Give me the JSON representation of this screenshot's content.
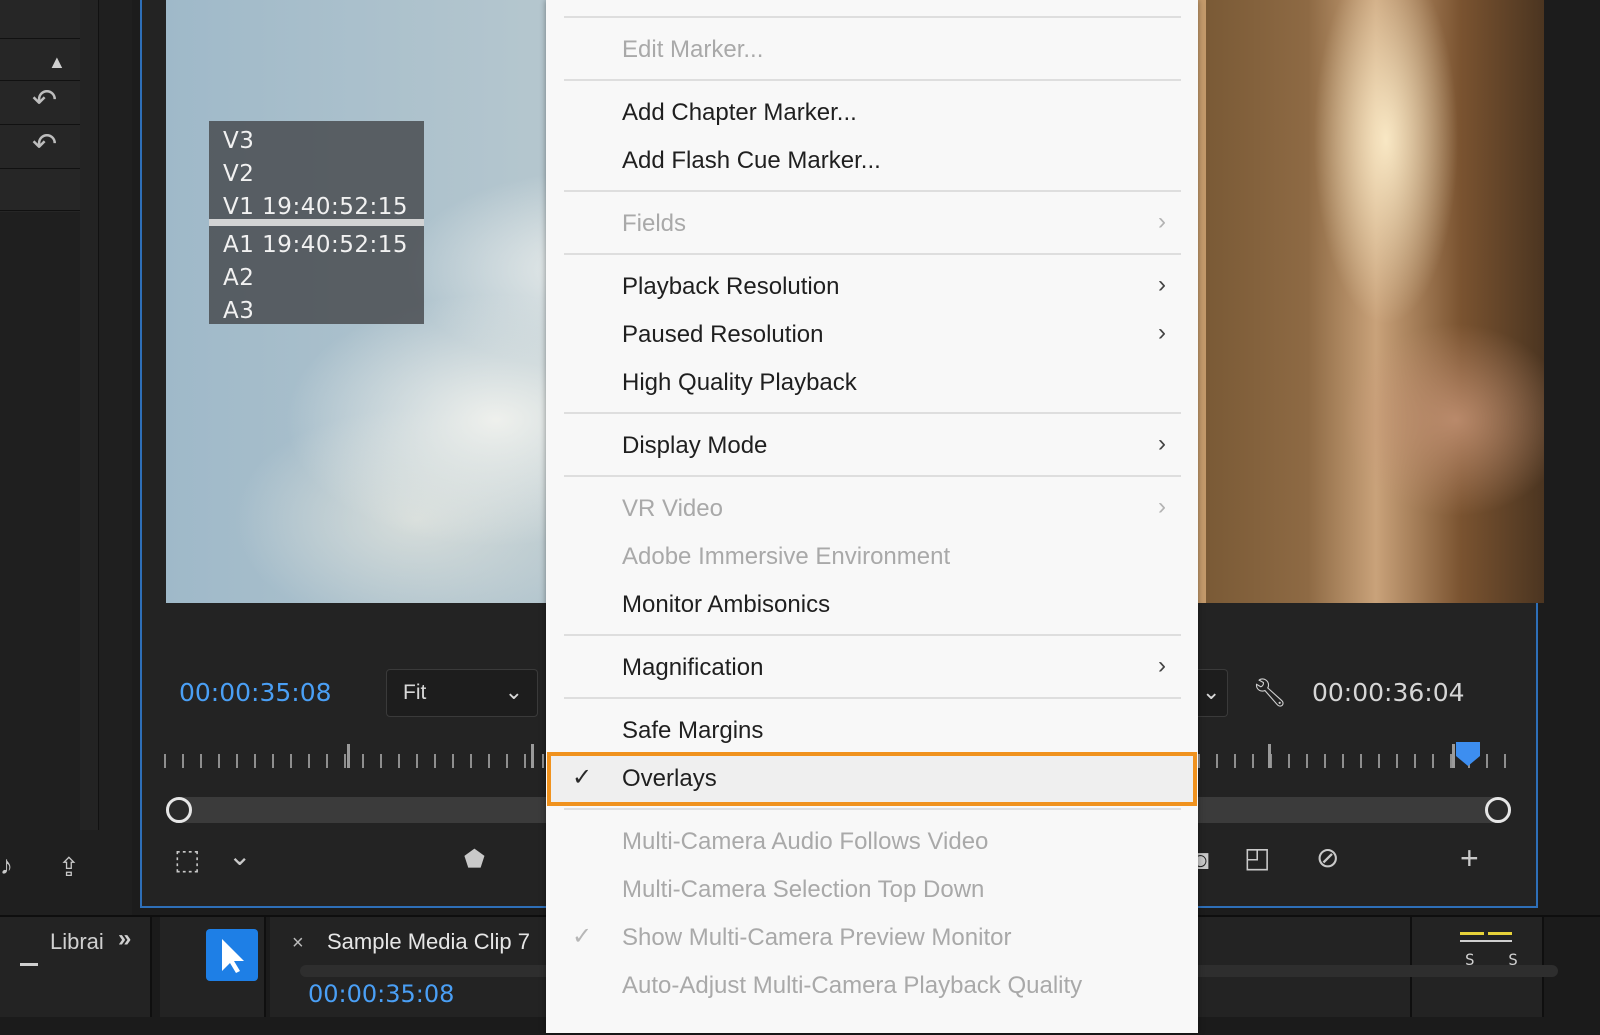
{
  "monitor": {
    "overlay_tracks": [
      "V3",
      "V2",
      "V1 19:40:52:15",
      "A1 19:40:52:15",
      "A2",
      "A3"
    ],
    "timecode_current": "00:00:35:08",
    "timecode_duration": "00:00:36:04",
    "zoom_select": "Fit",
    "playhead_fraction": 0.97
  },
  "bottom_bar": {
    "libraries_label": "Librai",
    "sequence_tab": "Sample Media Clip 7",
    "sequence_timecode": "00:00:35:08",
    "meter_labels": "S S"
  },
  "context_menu": {
    "items": [
      {
        "label": "Edit Marker...",
        "enabled": false,
        "submenu": false,
        "checked": false
      },
      {
        "label": "Add Chapter Marker...",
        "enabled": true,
        "submenu": false,
        "checked": false
      },
      {
        "label": "Add Flash Cue Marker...",
        "enabled": true,
        "submenu": false,
        "checked": false
      },
      {
        "label": "Fields",
        "enabled": false,
        "submenu": true,
        "checked": false
      },
      {
        "label": "Playback Resolution",
        "enabled": true,
        "submenu": true,
        "checked": false
      },
      {
        "label": "Paused Resolution",
        "enabled": true,
        "submenu": true,
        "checked": false
      },
      {
        "label": "High Quality Playback",
        "enabled": true,
        "submenu": false,
        "checked": false
      },
      {
        "label": "Display Mode",
        "enabled": true,
        "submenu": true,
        "checked": false
      },
      {
        "label": "VR Video",
        "enabled": false,
        "submenu": true,
        "checked": false
      },
      {
        "label": "Adobe Immersive Environment",
        "enabled": false,
        "submenu": false,
        "checked": false
      },
      {
        "label": "Monitor Ambisonics",
        "enabled": true,
        "submenu": false,
        "checked": false
      },
      {
        "label": "Magnification",
        "enabled": true,
        "submenu": true,
        "checked": false
      },
      {
        "label": "Safe Margins",
        "enabled": true,
        "submenu": false,
        "checked": false
      },
      {
        "label": "Overlays",
        "enabled": true,
        "submenu": false,
        "checked": true,
        "highlighted": true
      },
      {
        "label": "Multi-Camera Audio Follows Video",
        "enabled": false,
        "submenu": false,
        "checked": false
      },
      {
        "label": "Multi-Camera Selection Top Down",
        "enabled": false,
        "submenu": false,
        "checked": false
      },
      {
        "label": "Show Multi-Camera Preview Monitor",
        "enabled": false,
        "submenu": false,
        "checked": true
      },
      {
        "label": "Auto-Adjust Multi-Camera Playback Quality",
        "enabled": false,
        "submenu": false,
        "checked": false
      }
    ],
    "highlight_color": "#f0921e"
  },
  "icons": {
    "check": "✓",
    "submenu": "›",
    "chevron_down": "⌄",
    "double_chevron": "»",
    "close": "×"
  },
  "colors": {
    "timecode_accent": "#4a9ff5",
    "monitor_border": "#2e6fb8",
    "select_tool": "#1e7fe6"
  }
}
